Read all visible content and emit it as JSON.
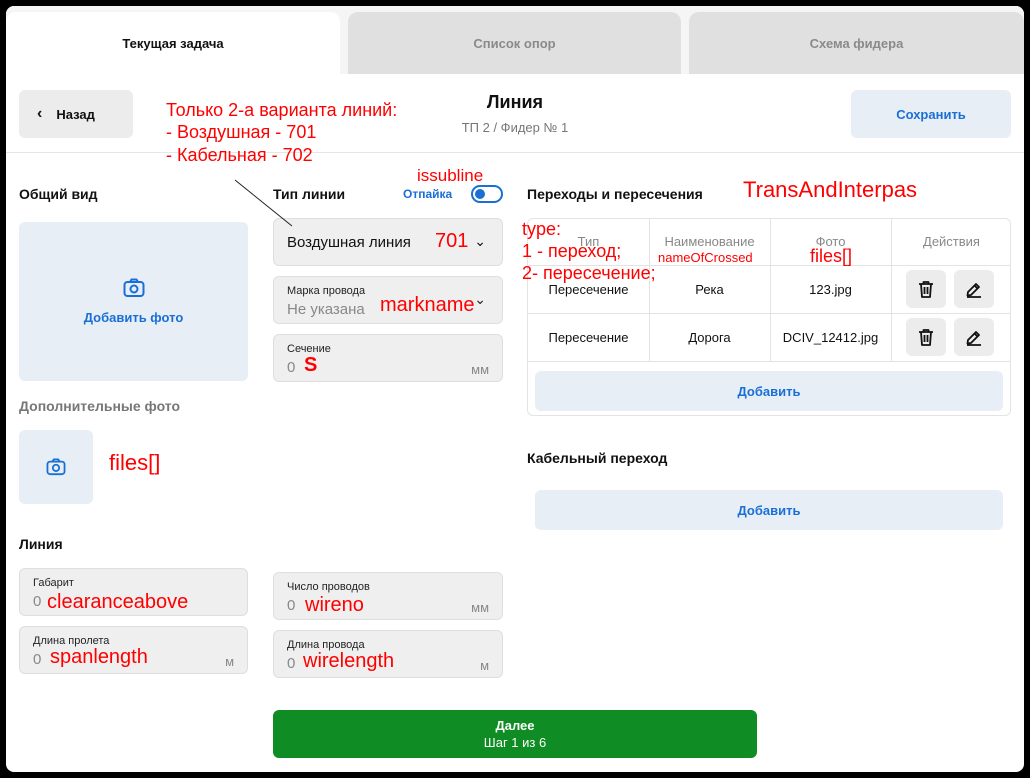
{
  "tabs": [
    {
      "label": "Текущая задача",
      "active": true
    },
    {
      "label": "Список опор",
      "active": false
    },
    {
      "label": "Схема фидера",
      "active": false
    }
  ],
  "header": {
    "back_label": "Назад",
    "title": "Линия",
    "subtitle": "ТП 2 / Фидер № 1",
    "save_label": "Сохранить"
  },
  "left": {
    "general_view_title": "Общий вид",
    "add_photo_label": "Добавить фото",
    "extra_photos_title": "Дополнительные фото",
    "line_title": "Линия"
  },
  "line_type": {
    "title": "Тип линии",
    "toggle_label": "Отпайка",
    "toggle_on": false,
    "selected": "Воздушная линия",
    "wire_mark_label": "Марка провода",
    "wire_mark_value": "Не указана",
    "section_label": "Сечение",
    "section_value": "0",
    "section_unit": "мм"
  },
  "line_fields": {
    "gabarit_label": "Габарит",
    "gabarit_value": "0",
    "span_label": "Длина пролета",
    "span_value": "0",
    "span_unit": "м",
    "wire_count_label": "Число проводов",
    "wire_count_value": "0",
    "wire_count_unit": "мм",
    "wire_length_label": "Длина провода",
    "wire_length_value": "0",
    "wire_length_unit": "м"
  },
  "crossings": {
    "title": "Переходы и пересечения",
    "columns": [
      "Тип",
      "Наименование",
      "Фото",
      "Действия"
    ],
    "rows": [
      {
        "type": "Пересечение",
        "name": "Река",
        "photo": "123.jpg"
      },
      {
        "type": "Пересечение",
        "name": "Дорога",
        "photo": "DCIV_12412.jpg"
      }
    ],
    "add_label": "Добавить"
  },
  "cable": {
    "title": "Кабельный переход",
    "add_label": "Добавить"
  },
  "next": {
    "label": "Далее",
    "step": "Шаг 1 из 6"
  },
  "annotations": {
    "line_variants_1": "Только 2-а варианта линий:",
    "line_variants_2": "- Воздушная - 701",
    "line_variants_3": "- Кабельная - 702",
    "issubline": "issubline",
    "trans": "TransAndInterpas",
    "type_1": "type:",
    "type_2": "1 - переход;",
    "type_3": "2- пересечение;",
    "name_of_crossed": "nameOfCrossed",
    "files_table": "files[]",
    "files_left": "files[]",
    "code_701": "701",
    "markname": "markname",
    "s": "S",
    "clearanceabove": "clearanceabove",
    "spanlength": "spanlength",
    "wireno": "wireno",
    "wirelength": "wirelength"
  },
  "colors": {
    "accent": "#1a6fd6",
    "primary_green": "#0f8c23",
    "annotation": "#ff0000"
  }
}
